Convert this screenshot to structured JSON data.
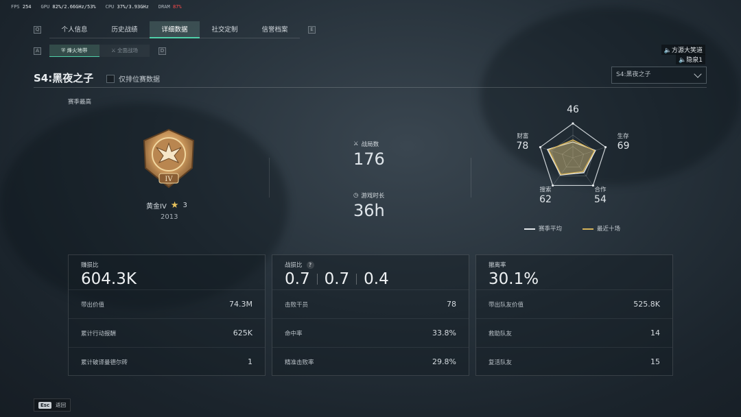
{
  "perf": {
    "fps_label": "FPS",
    "fps": "254",
    "gpu_label": "GPU",
    "gpu": "82%/2.66GHz/53%",
    "cpu_label": "CPU",
    "cpu": "37%/3.93GHz",
    "dram_label": "DRAM",
    "dram": "87%"
  },
  "nav": {
    "key_left": "Q",
    "key_right": "E",
    "tabs": [
      "个人信息",
      "历史战绩",
      "详细数据",
      "社交定制",
      "信誉档案"
    ],
    "active_tab": 2,
    "subkey_left": "A",
    "subkey_right": "D",
    "subtabs": [
      "烽火地带",
      "全面战场"
    ],
    "active_subtab": 0
  },
  "voice": [
    "方源大笑道",
    "隐泉1"
  ],
  "season": {
    "title": "S4:黑夜之子",
    "ranked_only_label": "仅排位赛数据",
    "select_value": "S4:黑夜之子"
  },
  "rank": {
    "section_label": "赛季最高",
    "name": "黄金IV",
    "stars": "3",
    "score": "2013",
    "badge_numeral": "IV"
  },
  "summary": {
    "matches_label": "战局数",
    "matches": "176",
    "playtime_label": "游戏时长",
    "playtime": "36h"
  },
  "radar": {
    "axes": [
      {
        "label": "战斗",
        "value": "46",
        "season_avg": 46,
        "recent": 52
      },
      {
        "label": "生存",
        "value": "69",
        "season_avg": 69,
        "recent": 66
      },
      {
        "label": "合作",
        "value": "54",
        "season_avg": 54,
        "recent": 50
      },
      {
        "label": "搜索",
        "value": "62",
        "season_avg": 62,
        "recent": 60
      },
      {
        "label": "财富",
        "value": "78",
        "season_avg": 78,
        "recent": 74
      }
    ],
    "legend_avg": "赛季平均",
    "legend_recent": "最近十场",
    "color_avg": "#e6eaed",
    "color_recent": "#d7b45a"
  },
  "cards": [
    {
      "head_label": "赚损比",
      "head_value": "604.3K",
      "rows": [
        {
          "label": "带出价值",
          "value": "74.3M"
        },
        {
          "label": "累计行动报酬",
          "value": "625K"
        },
        {
          "label": "累计破译曼德尔砖",
          "value": "1"
        }
      ]
    },
    {
      "head_label": "战损比",
      "head_values": [
        "0.7",
        "0.7",
        "0.4"
      ],
      "help": "?",
      "rows": [
        {
          "label": "击败干员",
          "value": "78"
        },
        {
          "label": "命中率",
          "value": "33.8%"
        },
        {
          "label": "精准击败率",
          "value": "29.8%"
        }
      ]
    },
    {
      "head_label": "撤离率",
      "head_value": "30.1%",
      "rows": [
        {
          "label": "带出队友价值",
          "value": "525.8K"
        },
        {
          "label": "救助队友",
          "value": "14"
        },
        {
          "label": "复活队友",
          "value": "15"
        }
      ]
    }
  ],
  "footer": {
    "key": "Esc",
    "label": "返回"
  }
}
